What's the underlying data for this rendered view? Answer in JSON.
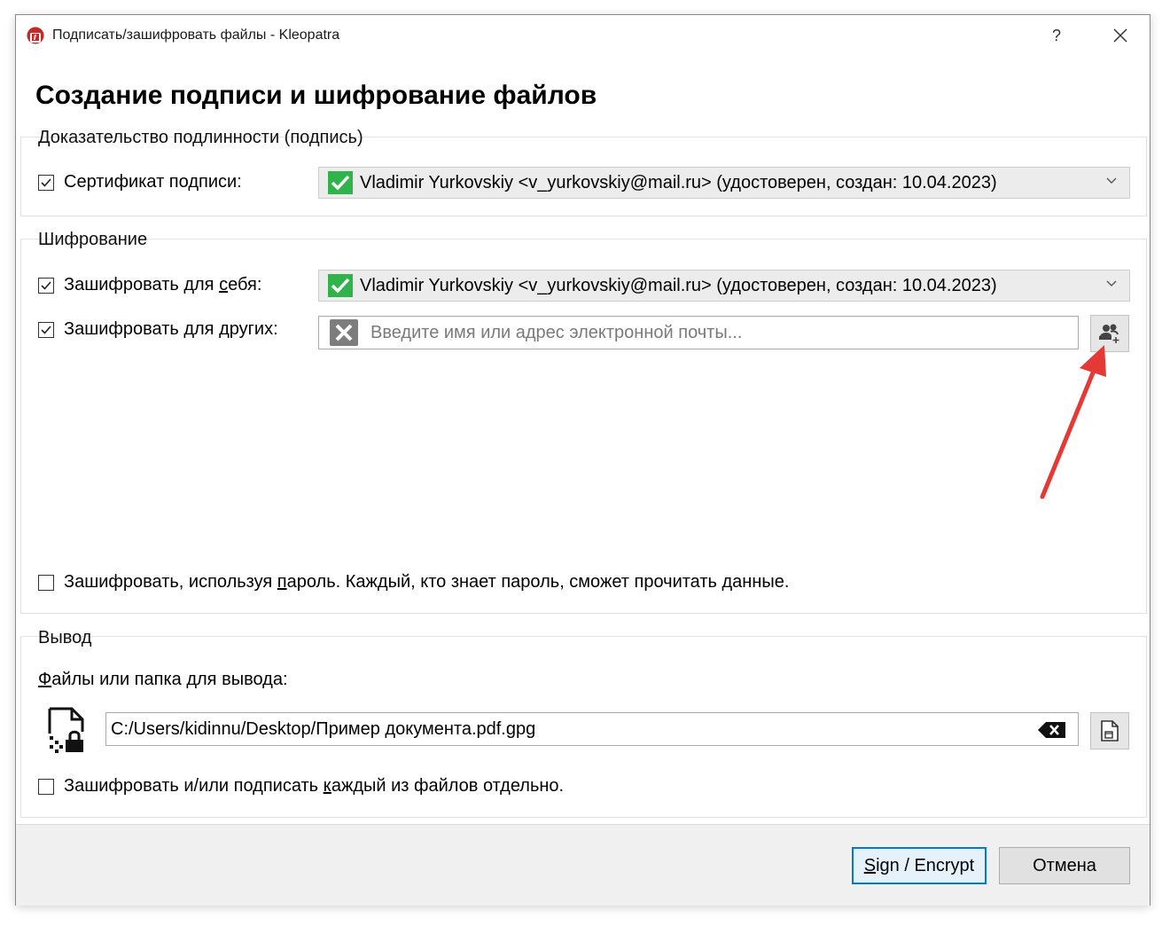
{
  "window": {
    "title": "Подписать/зашифровать файлы - Kleopatra",
    "help_label": "?",
    "heading": "Создание подписи и шифрование файлов"
  },
  "signature": {
    "group_title": "Доказательство подлинности (подпись)",
    "checkbox_label": "Сертификат подписи:",
    "checked": true,
    "certificate": "Vladimir Yurkovskiy <v_yurkovskiy@mail.ru> (удостоверен, создан: 10.04.2023)"
  },
  "encryption": {
    "group_title": "Шифрование",
    "self_label_prefix": "Зашифровать для ",
    "self_label_key": "с",
    "self_label_suffix": "ебя:",
    "self_checked": true,
    "self_certificate": "Vladimir Yurkovskiy <v_yurkovskiy@mail.ru> (удостоверен, создан: 10.04.2023)",
    "others_label": "Зашифровать для других:",
    "others_checked": true,
    "others_placeholder": "Введите имя или адрес электронной почты...",
    "password_label_prefix": "Зашифровать, используя ",
    "password_label_key": "п",
    "password_label_suffix": "ароль. Каждый, кто знает пароль, сможет прочитать данные.",
    "password_checked": false
  },
  "output": {
    "group_title": "Вывод",
    "path_label_key": "Ф",
    "path_label_rest": "айлы или папка для вывода:",
    "path_value": "C:/Users/kidinnu/Desktop/Пример документа.pdf.gpg",
    "separate_label_prefix": "Зашифровать и/или подписать ",
    "separate_label_key": "к",
    "separate_label_suffix": "аждый из файлов отдельно.",
    "separate_checked": false
  },
  "buttons": {
    "sign_encrypt_key": "S",
    "sign_encrypt_rest": "ign / Encrypt",
    "cancel": "Отмена"
  },
  "colors": {
    "accent": "#0078d7",
    "valid_green": "#2fb34a",
    "annotation_red": "#e53935"
  }
}
